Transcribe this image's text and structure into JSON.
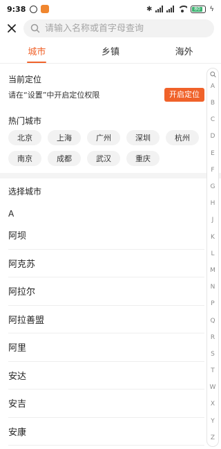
{
  "status_bar": {
    "time": "9:38",
    "battery_level": 0.8,
    "battery_label": "80"
  },
  "search": {
    "placeholder": "请输入名称或首字母查询"
  },
  "tabs": [
    {
      "label": "城市",
      "active": true
    },
    {
      "label": "乡镇",
      "active": false
    },
    {
      "label": "海外",
      "active": false
    }
  ],
  "location": {
    "title": "当前定位",
    "hint": "请在“设置”中开启定位权限",
    "button_label": "开启定位"
  },
  "hot_cities": {
    "title": "热门城市",
    "items": [
      "北京",
      "上海",
      "广州",
      "深圳",
      "杭州",
      "南京",
      "成都",
      "武汉",
      "重庆"
    ]
  },
  "city_select": {
    "title": "选择城市",
    "current_letter": "A",
    "cities": [
      "阿坝",
      "阿克苏",
      "阿拉尔",
      "阿拉善盟",
      "阿里",
      "安达",
      "安吉",
      "安康"
    ]
  },
  "index_letters": [
    "A",
    "B",
    "C",
    "D",
    "E",
    "F",
    "G",
    "H",
    "J",
    "K",
    "L",
    "M",
    "N",
    "P",
    "Q",
    "R",
    "S",
    "T",
    "W",
    "X",
    "Y",
    "Z"
  ],
  "colors": {
    "accent": "#f0622a",
    "chip_bg": "#f2f2f2"
  }
}
